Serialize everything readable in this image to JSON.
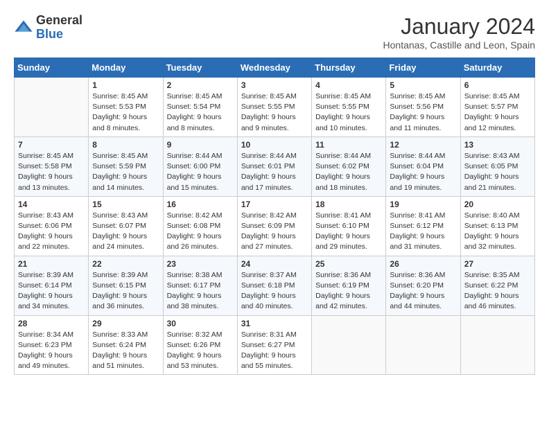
{
  "logo": {
    "general": "General",
    "blue": "Blue"
  },
  "title": "January 2024",
  "subtitle": "Hontanas, Castille and Leon, Spain",
  "days": [
    "Sunday",
    "Monday",
    "Tuesday",
    "Wednesday",
    "Thursday",
    "Friday",
    "Saturday"
  ],
  "weeks": [
    [
      {
        "num": "",
        "lines": []
      },
      {
        "num": "1",
        "lines": [
          "Sunrise: 8:45 AM",
          "Sunset: 5:53 PM",
          "Daylight: 9 hours",
          "and 8 minutes."
        ]
      },
      {
        "num": "2",
        "lines": [
          "Sunrise: 8:45 AM",
          "Sunset: 5:54 PM",
          "Daylight: 9 hours",
          "and 8 minutes."
        ]
      },
      {
        "num": "3",
        "lines": [
          "Sunrise: 8:45 AM",
          "Sunset: 5:55 PM",
          "Daylight: 9 hours",
          "and 9 minutes."
        ]
      },
      {
        "num": "4",
        "lines": [
          "Sunrise: 8:45 AM",
          "Sunset: 5:55 PM",
          "Daylight: 9 hours",
          "and 10 minutes."
        ]
      },
      {
        "num": "5",
        "lines": [
          "Sunrise: 8:45 AM",
          "Sunset: 5:56 PM",
          "Daylight: 9 hours",
          "and 11 minutes."
        ]
      },
      {
        "num": "6",
        "lines": [
          "Sunrise: 8:45 AM",
          "Sunset: 5:57 PM",
          "Daylight: 9 hours",
          "and 12 minutes."
        ]
      }
    ],
    [
      {
        "num": "7",
        "lines": [
          "Sunrise: 8:45 AM",
          "Sunset: 5:58 PM",
          "Daylight: 9 hours",
          "and 13 minutes."
        ]
      },
      {
        "num": "8",
        "lines": [
          "Sunrise: 8:45 AM",
          "Sunset: 5:59 PM",
          "Daylight: 9 hours",
          "and 14 minutes."
        ]
      },
      {
        "num": "9",
        "lines": [
          "Sunrise: 8:44 AM",
          "Sunset: 6:00 PM",
          "Daylight: 9 hours",
          "and 15 minutes."
        ]
      },
      {
        "num": "10",
        "lines": [
          "Sunrise: 8:44 AM",
          "Sunset: 6:01 PM",
          "Daylight: 9 hours",
          "and 17 minutes."
        ]
      },
      {
        "num": "11",
        "lines": [
          "Sunrise: 8:44 AM",
          "Sunset: 6:02 PM",
          "Daylight: 9 hours",
          "and 18 minutes."
        ]
      },
      {
        "num": "12",
        "lines": [
          "Sunrise: 8:44 AM",
          "Sunset: 6:04 PM",
          "Daylight: 9 hours",
          "and 19 minutes."
        ]
      },
      {
        "num": "13",
        "lines": [
          "Sunrise: 8:43 AM",
          "Sunset: 6:05 PM",
          "Daylight: 9 hours",
          "and 21 minutes."
        ]
      }
    ],
    [
      {
        "num": "14",
        "lines": [
          "Sunrise: 8:43 AM",
          "Sunset: 6:06 PM",
          "Daylight: 9 hours",
          "and 22 minutes."
        ]
      },
      {
        "num": "15",
        "lines": [
          "Sunrise: 8:43 AM",
          "Sunset: 6:07 PM",
          "Daylight: 9 hours",
          "and 24 minutes."
        ]
      },
      {
        "num": "16",
        "lines": [
          "Sunrise: 8:42 AM",
          "Sunset: 6:08 PM",
          "Daylight: 9 hours",
          "and 26 minutes."
        ]
      },
      {
        "num": "17",
        "lines": [
          "Sunrise: 8:42 AM",
          "Sunset: 6:09 PM",
          "Daylight: 9 hours",
          "and 27 minutes."
        ]
      },
      {
        "num": "18",
        "lines": [
          "Sunrise: 8:41 AM",
          "Sunset: 6:10 PM",
          "Daylight: 9 hours",
          "and 29 minutes."
        ]
      },
      {
        "num": "19",
        "lines": [
          "Sunrise: 8:41 AM",
          "Sunset: 6:12 PM",
          "Daylight: 9 hours",
          "and 31 minutes."
        ]
      },
      {
        "num": "20",
        "lines": [
          "Sunrise: 8:40 AM",
          "Sunset: 6:13 PM",
          "Daylight: 9 hours",
          "and 32 minutes."
        ]
      }
    ],
    [
      {
        "num": "21",
        "lines": [
          "Sunrise: 8:39 AM",
          "Sunset: 6:14 PM",
          "Daylight: 9 hours",
          "and 34 minutes."
        ]
      },
      {
        "num": "22",
        "lines": [
          "Sunrise: 8:39 AM",
          "Sunset: 6:15 PM",
          "Daylight: 9 hours",
          "and 36 minutes."
        ]
      },
      {
        "num": "23",
        "lines": [
          "Sunrise: 8:38 AM",
          "Sunset: 6:17 PM",
          "Daylight: 9 hours",
          "and 38 minutes."
        ]
      },
      {
        "num": "24",
        "lines": [
          "Sunrise: 8:37 AM",
          "Sunset: 6:18 PM",
          "Daylight: 9 hours",
          "and 40 minutes."
        ]
      },
      {
        "num": "25",
        "lines": [
          "Sunrise: 8:36 AM",
          "Sunset: 6:19 PM",
          "Daylight: 9 hours",
          "and 42 minutes."
        ]
      },
      {
        "num": "26",
        "lines": [
          "Sunrise: 8:36 AM",
          "Sunset: 6:20 PM",
          "Daylight: 9 hours",
          "and 44 minutes."
        ]
      },
      {
        "num": "27",
        "lines": [
          "Sunrise: 8:35 AM",
          "Sunset: 6:22 PM",
          "Daylight: 9 hours",
          "and 46 minutes."
        ]
      }
    ],
    [
      {
        "num": "28",
        "lines": [
          "Sunrise: 8:34 AM",
          "Sunset: 6:23 PM",
          "Daylight: 9 hours",
          "and 49 minutes."
        ]
      },
      {
        "num": "29",
        "lines": [
          "Sunrise: 8:33 AM",
          "Sunset: 6:24 PM",
          "Daylight: 9 hours",
          "and 51 minutes."
        ]
      },
      {
        "num": "30",
        "lines": [
          "Sunrise: 8:32 AM",
          "Sunset: 6:26 PM",
          "Daylight: 9 hours",
          "and 53 minutes."
        ]
      },
      {
        "num": "31",
        "lines": [
          "Sunrise: 8:31 AM",
          "Sunset: 6:27 PM",
          "Daylight: 9 hours",
          "and 55 minutes."
        ]
      },
      {
        "num": "",
        "lines": []
      },
      {
        "num": "",
        "lines": []
      },
      {
        "num": "",
        "lines": []
      }
    ]
  ]
}
